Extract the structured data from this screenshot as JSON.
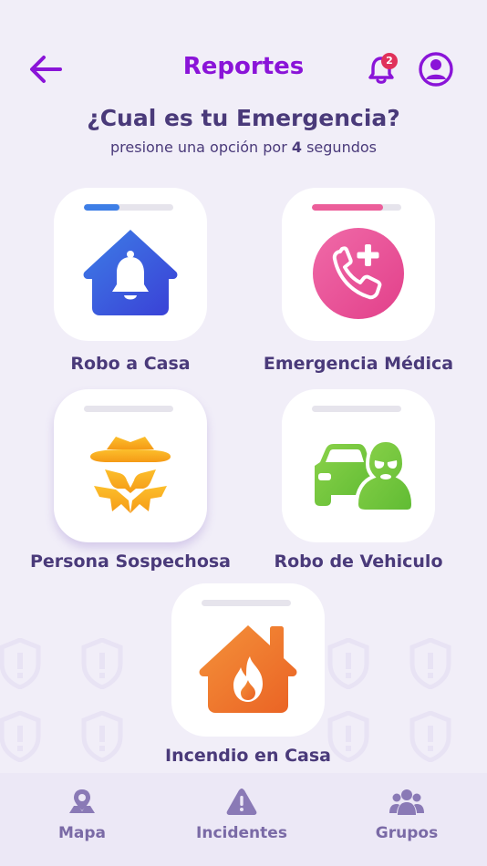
{
  "header": {
    "title": "Reportes",
    "notification_count": "2"
  },
  "prompt": {
    "question": "¿Cual es tu Emergencia?",
    "instruction_before": "presione una opción por ",
    "instruction_seconds": "4",
    "instruction_after": " segundos"
  },
  "emergencies": [
    {
      "label": "Robo a Casa",
      "icon": "house-bell-icon",
      "progress": 0.4,
      "progress_color": "#3d7ee6",
      "icon_color": "#3a5be6"
    },
    {
      "label": "Emergencia Médica",
      "icon": "medical-phone-icon",
      "progress": 0.8,
      "progress_color": "#ec5e9a",
      "icon_color": "#ea4f8f"
    },
    {
      "label": "Persona Sospechosa",
      "icon": "suspect-person-icon",
      "progress": 0,
      "progress_color": "#e6e4ec",
      "icon_color": "#f7a81f"
    },
    {
      "label": "Robo de Vehiculo",
      "icon": "car-thief-icon",
      "progress": 0,
      "progress_color": "#e6e4ec",
      "icon_color": "#72c63d"
    },
    {
      "label": "Incendio en Casa",
      "icon": "house-fire-icon",
      "progress": 0,
      "progress_color": "#e6e4ec",
      "icon_color": "#f07a2a"
    }
  ],
  "nav": {
    "items": [
      {
        "label": "Mapa",
        "icon": "map-pin-icon"
      },
      {
        "label": "Incidentes",
        "icon": "warning-icon"
      },
      {
        "label": "Grupos",
        "icon": "group-icon"
      }
    ]
  },
  "colors": {
    "accent": "#8a14d8",
    "text": "#4a3a7a",
    "background": "#f1eef8",
    "badge": "#e0315a"
  }
}
